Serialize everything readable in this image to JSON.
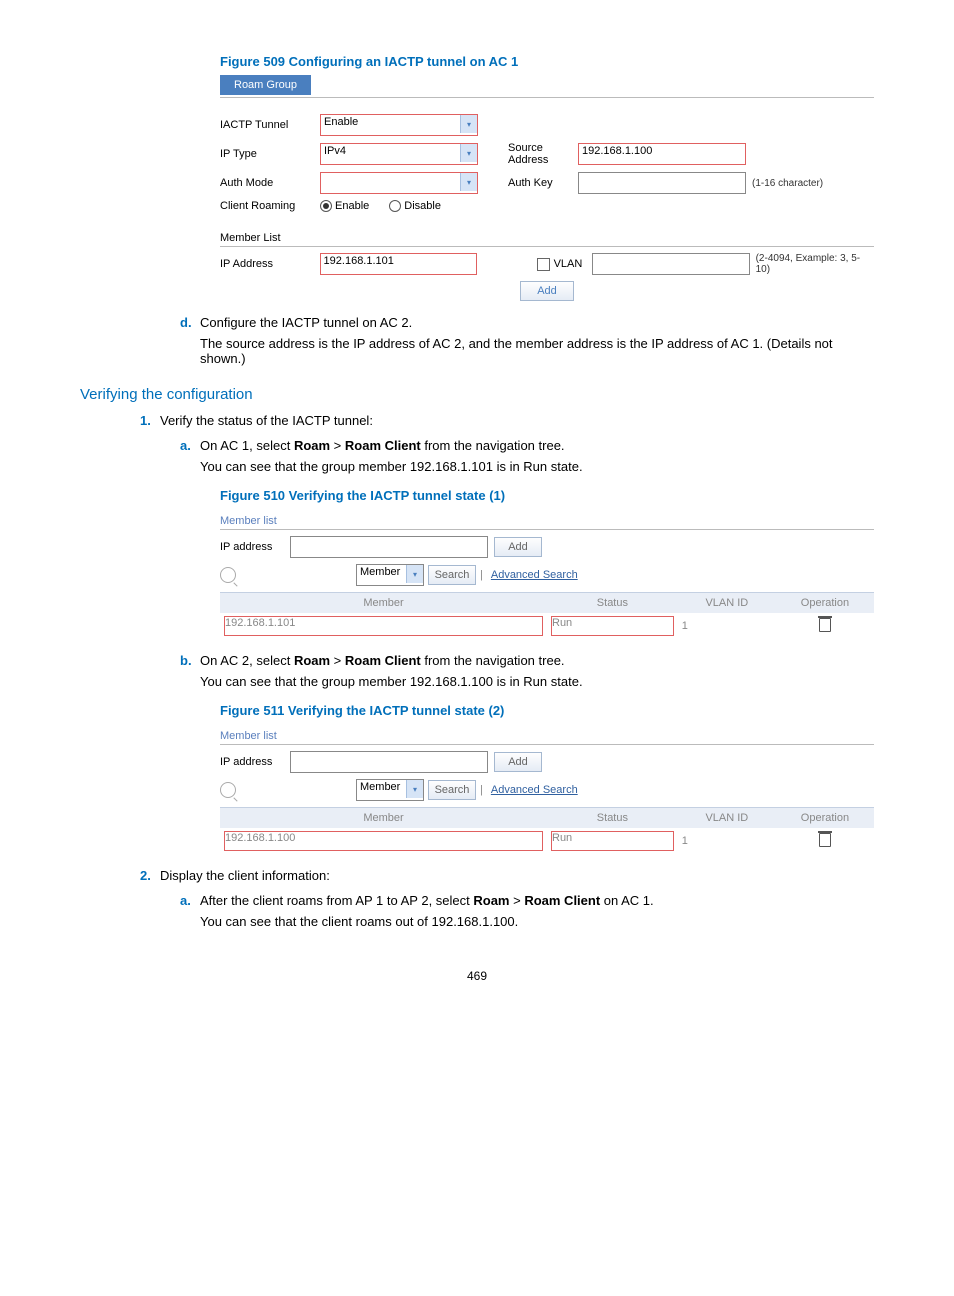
{
  "fig509": {
    "caption": "Figure 509 Configuring an IACTP tunnel on AC 1",
    "tab": "Roam Group",
    "rows": {
      "iactp_label": "IACTP Tunnel",
      "iactp_value": "Enable",
      "iptype_label": "IP Type",
      "iptype_value": "IPv4",
      "srcaddr_label": "Source Address",
      "srcaddr_value": "192.168.1.100",
      "authmode_label": "Auth Mode",
      "authmode_value": "",
      "authkey_label": "Auth Key",
      "authkey_hint": "(1-16 character)",
      "clientroam_label": "Client Roaming",
      "clientroam_enable": "Enable",
      "clientroam_disable": "Disable"
    },
    "member_list_label": "Member List",
    "ipaddr_label": "IP Address",
    "ipaddr_value": "192.168.1.101",
    "vlan_label": "VLAN",
    "vlan_hint": "(2-4094, Example: 3, 5-10)",
    "add_btn": "Add"
  },
  "step_d": {
    "marker": "d.",
    "line1": "Configure the IACTP tunnel on AC 2.",
    "line2": "The source address is the IP address of AC 2, and the member address is the IP address of AC 1. (Details not shown.)"
  },
  "h2": "Verifying the configuration",
  "step1": {
    "marker": "1.",
    "text": "Verify the status of the IACTP tunnel:"
  },
  "step1a": {
    "marker": "a.",
    "line1_pre": "On AC 1, select ",
    "line1_roam": "Roam",
    "line1_gt": " > ",
    "line1_roamclient": "Roam Client",
    "line1_post": " from the navigation tree.",
    "line2": "You can see that the group member 192.168.1.101 is in Run state."
  },
  "fig510": {
    "caption": "Figure 510 Verifying the IACTP tunnel state (1)",
    "member_list": "Member list",
    "ip_label": "IP address",
    "add_btn": "Add",
    "member_dd": "Member",
    "search_btn": "Search",
    "adv_search": "Advanced Search",
    "th_member": "Member",
    "th_status": "Status",
    "th_vlan": "VLAN ID",
    "th_op": "Operation",
    "row_member": "192.168.1.101",
    "row_status": "Run",
    "row_vlan": "1"
  },
  "step1b": {
    "marker": "b.",
    "line1_pre": "On AC 2, select ",
    "line1_roam": "Roam",
    "line1_gt": " > ",
    "line1_roamclient": "Roam Client",
    "line1_post": " from the navigation tree.",
    "line2": "You can see that the group member 192.168.1.100 is in Run state."
  },
  "fig511": {
    "caption": "Figure 511 Verifying the IACTP tunnel state (2)",
    "member_list": "Member list",
    "ip_label": "IP address",
    "add_btn": "Add",
    "member_dd": "Member",
    "search_btn": "Search",
    "adv_search": "Advanced Search",
    "th_member": "Member",
    "th_status": "Status",
    "th_vlan": "VLAN ID",
    "th_op": "Operation",
    "row_member": "192.168.1.100",
    "row_status": "Run",
    "row_vlan": "1"
  },
  "step2": {
    "marker": "2.",
    "text": "Display the client information:"
  },
  "step2a": {
    "marker": "a.",
    "line1_pre": "After the client roams from AP 1 to AP 2, select ",
    "line1_roam": "Roam",
    "line1_gt": " > ",
    "line1_roamclient": "Roam Client",
    "line1_post": " on AC 1.",
    "line2": "You can see that the client roams out of 192.168.1.100."
  },
  "page_number": "469"
}
